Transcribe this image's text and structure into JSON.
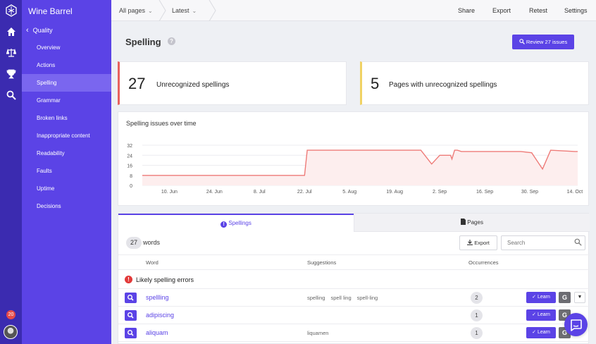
{
  "sidebar": {
    "brand": "Wine Barrel",
    "back_label": "Quality",
    "items": [
      {
        "label": "Overview"
      },
      {
        "label": "Actions"
      },
      {
        "label": "Spelling",
        "active": true
      },
      {
        "label": "Grammar"
      },
      {
        "label": "Broken links"
      },
      {
        "label": "Inappropriate content"
      },
      {
        "label": "Readability"
      },
      {
        "label": "Faults"
      },
      {
        "label": "Uptime"
      },
      {
        "label": "Decisions"
      }
    ],
    "notification_count": "20"
  },
  "rail": {
    "icons": [
      "logo-icon",
      "home-icon",
      "scale-icon",
      "trophy-icon",
      "search-icon"
    ]
  },
  "topbar": {
    "filter_pages": "All pages",
    "filter_version": "Latest",
    "share": "Share",
    "export": "Export",
    "retest": "Retest",
    "settings": "Settings"
  },
  "header": {
    "title": "Spelling",
    "review_button": "Review 27 issues"
  },
  "stats": [
    {
      "value": "27",
      "label": "Unrecognized spellings",
      "accent": "#e8625f"
    },
    {
      "value": "5",
      "label": "Pages with unrecognized spellings",
      "accent": "#f0d264"
    }
  ],
  "chart_title": "Spelling issues over time",
  "chart_data": {
    "type": "area",
    "ylim": [
      0,
      32
    ],
    "y_ticks": [
      "32",
      "24",
      "16",
      "8",
      "0"
    ],
    "x_ticks": [
      "10. Jun",
      "24. Jun",
      "8. Jul",
      "22. Jul",
      "5. Aug",
      "19. Aug",
      "2. Sep",
      "16. Sep",
      "30. Sep",
      "14. Oct"
    ],
    "x": [
      0,
      2,
      4,
      6,
      6.1,
      8,
      10,
      10.3,
      10.7,
      11,
      11.4,
      11.45,
      11.55,
      11.65,
      11.8,
      13,
      14,
      14.4,
      14.8,
      15.1,
      16,
      16.1
    ],
    "values": [
      8,
      8,
      8,
      8,
      28,
      28,
      28,
      28,
      17,
      24,
      24,
      21,
      28,
      28,
      27,
      27,
      27,
      26,
      13,
      28,
      27,
      27
    ],
    "line_color": "#ee7b78"
  },
  "tabs": {
    "spellings": "Spellings",
    "pages": "Pages"
  },
  "table": {
    "count": "27",
    "count_label": "words",
    "export_label": "Export",
    "search_placeholder": "Search",
    "columns": {
      "word": "Word",
      "suggestions": "Suggestions",
      "occurrences": "Occurrences"
    },
    "group_label": "Likely spelling errors",
    "learn_label": "Learn",
    "g_label": "G",
    "rows": [
      {
        "word": "spellling",
        "suggestions": [
          "spelling",
          "spell ling",
          "spell-ling"
        ],
        "occurrences": "2"
      },
      {
        "word": "adipiscing",
        "suggestions": [],
        "occurrences": "1"
      },
      {
        "word": "aliquam",
        "suggestions": [
          "liquamen"
        ],
        "occurrences": "1"
      }
    ]
  }
}
